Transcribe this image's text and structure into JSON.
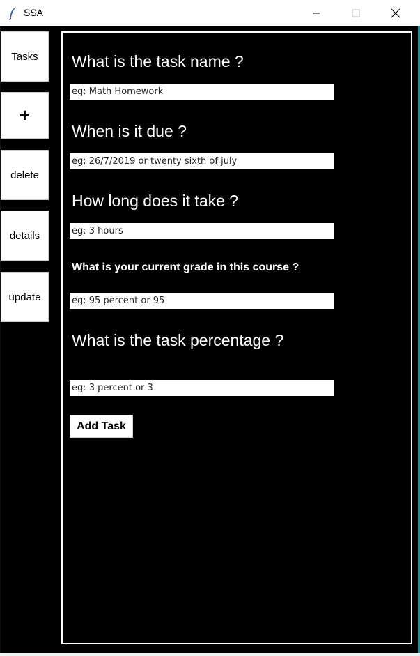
{
  "window": {
    "title": "SSA",
    "app_icon": "feather-icon",
    "controls": {
      "minimize": "minimize-icon",
      "maximize": "maximize-icon",
      "close": "close-icon"
    }
  },
  "sidebar": {
    "items": [
      {
        "label": "Tasks"
      },
      {
        "label": "+"
      },
      {
        "label": "delete"
      },
      {
        "label": "details"
      },
      {
        "label": "update"
      }
    ]
  },
  "form": {
    "task_name_label": "What is the task name ?",
    "task_name_placeholder": "eg: Math Homework",
    "due_label": "When is it due ?",
    "due_placeholder": "eg: 26/7/2019 or twenty sixth of july",
    "duration_label": "How long does it take ?",
    "duration_placeholder": "eg: 3 hours",
    "grade_label": "What is your current grade in this course ?",
    "grade_placeholder": "eg: 95 percent or 95",
    "percentage_label": "What is the task percentage ?",
    "percentage_placeholder": "eg: 3 percent or 3",
    "submit_label": "Add Task"
  },
  "colors": {
    "background": "#000000",
    "panel_border": "#ffffff",
    "accent": "#2a8c8c"
  }
}
